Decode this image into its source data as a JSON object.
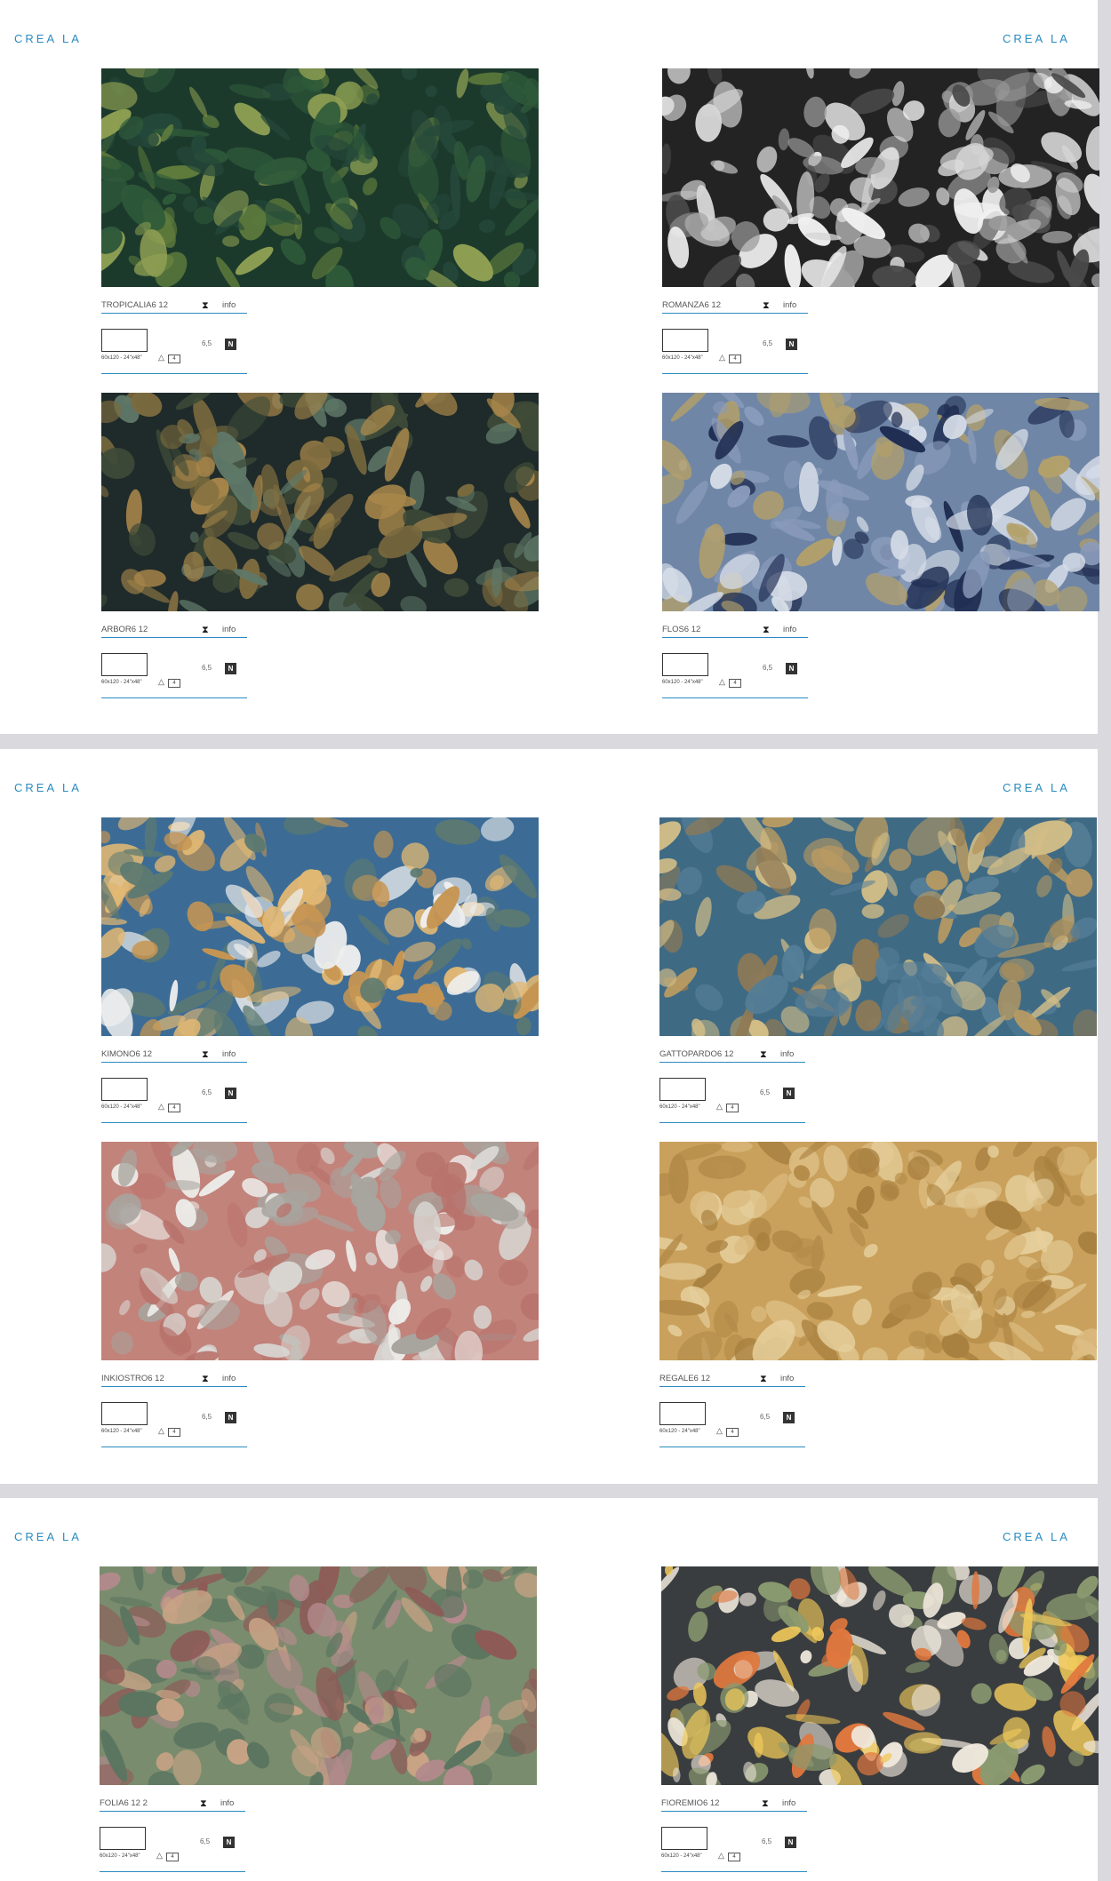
{
  "brand": "CREA LA",
  "common": {
    "size_label": "60x120 - 24\"x48\"",
    "thickness": "6,5",
    "badge": "N",
    "info_label": "info",
    "hourglass": "⧗",
    "triangle": "△",
    "package": "4"
  },
  "products": [
    {
      "name": "TROPICALIA6 12",
      "colors": [
        "#1c3a2c",
        "#2f5a3a",
        "#5f7c3c",
        "#8fa053",
        "#24483a"
      ]
    },
    {
      "name": "ROMANZA6 12",
      "colors": [
        "#232323",
        "#4a4a4a",
        "#9a9a9a",
        "#d5d5d5",
        "#f0f0f0"
      ]
    },
    {
      "name": "ARBOR6 12",
      "colors": [
        "#1f2a2a",
        "#3d4a38",
        "#7a6a3e",
        "#a7864a",
        "#5f7868"
      ]
    },
    {
      "name": "FLOS6 12",
      "colors": [
        "#6f86a6",
        "#1f2d52",
        "#d6dde8",
        "#8a9bbb",
        "#b3a06a"
      ]
    },
    {
      "name": "KIMONO6 12",
      "colors": [
        "#3c6c95",
        "#e2b873",
        "#c69552",
        "#eeeeee",
        "#5d7a70"
      ]
    },
    {
      "name": "GATTOPARDO6 12",
      "colors": [
        "#3f6a84",
        "#b89a62",
        "#8f7a55",
        "#547d97",
        "#d2bd87"
      ]
    },
    {
      "name": "INKIOSTRO6 12",
      "colors": [
        "#c2837b",
        "#ecebe8",
        "#d8d6d2",
        "#a8a49e",
        "#b8736c"
      ]
    },
    {
      "name": "REGALE6 12",
      "colors": [
        "#c9a15c",
        "#b38a48",
        "#dcbd82",
        "#a8803f",
        "#e6cf9c"
      ]
    },
    {
      "name": "FOLIA6 12 2",
      "colors": [
        "#7a8c6e",
        "#b48a8c",
        "#5b7560",
        "#c9a385",
        "#8e5a56"
      ]
    },
    {
      "name": "FIOREMIO6 12",
      "colors": [
        "#3a3d3f",
        "#e0783e",
        "#f0c95a",
        "#efe8dc",
        "#8a9a70"
      ]
    }
  ]
}
